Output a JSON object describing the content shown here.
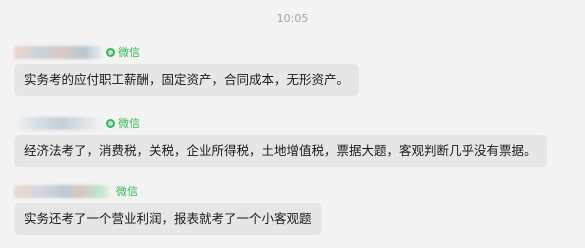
{
  "timestamp": "10:05",
  "messages": [
    {
      "source_label": "微信",
      "text": "实务考的应付职工薪酬，固定资产，合同成本，无形资产。"
    },
    {
      "source_label": "微信",
      "text": "经济法考了，消费税，关税，企业所得税，土地增值税，票据大题，客观判断几乎没有票据。"
    },
    {
      "source_label": "微信",
      "text": "实务还考了一个营业利润，报表就考了一个小客观题"
    }
  ],
  "colors": {
    "background": "#f3f3f3",
    "bubble": "#e6e6e6",
    "wechat_green": "#37b75b",
    "timestamp": "#a3a3a3"
  }
}
